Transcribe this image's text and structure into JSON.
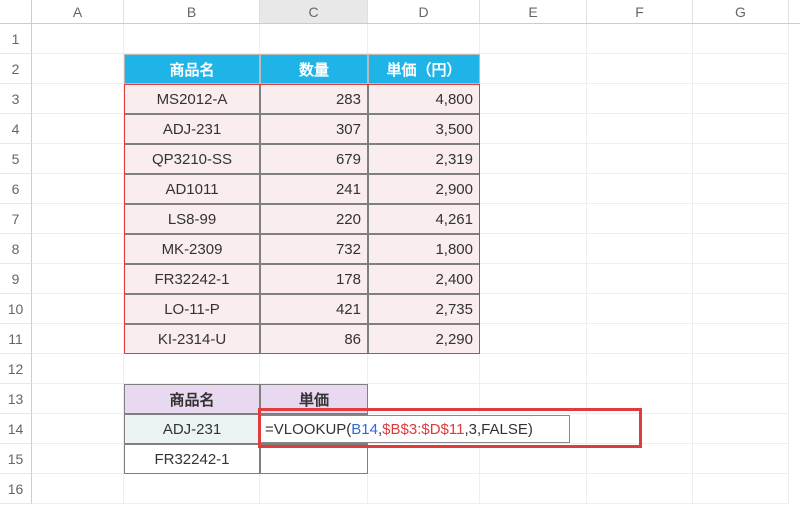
{
  "columns": [
    "A",
    "B",
    "C",
    "D",
    "E",
    "F",
    "G"
  ],
  "selected_column_idx": 2,
  "rows": [
    "1",
    "2",
    "3",
    "4",
    "5",
    "6",
    "7",
    "8",
    "9",
    "10",
    "11",
    "12",
    "13",
    "14",
    "15",
    "16"
  ],
  "table1": {
    "headers": {
      "name": "商品名",
      "qty": "数量",
      "price": "単価（円）"
    },
    "data": [
      {
        "name": "MS2012-A",
        "qty": "283",
        "price": "4,800"
      },
      {
        "name": "ADJ-231",
        "qty": "307",
        "price": "3,500"
      },
      {
        "name": "QP3210-SS",
        "qty": "679",
        "price": "2,319"
      },
      {
        "name": "AD1011",
        "qty": "241",
        "price": "2,900"
      },
      {
        "name": "LS8-99",
        "qty": "220",
        "price": "4,261"
      },
      {
        "name": "MK-2309",
        "qty": "732",
        "price": "1,800"
      },
      {
        "name": "FR32242-1",
        "qty": "178",
        "price": "2,400"
      },
      {
        "name": "LO-11-P",
        "qty": "421",
        "price": "2,735"
      },
      {
        "name": "KI-2314-U",
        "qty": "86",
        "price": "2,290"
      }
    ]
  },
  "lookup": {
    "headers": {
      "name": "商品名",
      "price": "単価"
    },
    "rows": [
      {
        "name": "ADJ-231"
      },
      {
        "name": "FR32242-1"
      }
    ]
  },
  "formula": {
    "raw": "=VLOOKUP(B14,$B$3:$D$11,3,FALSE)",
    "prefix": "=VLOOKUP(",
    "ref1": "B14",
    "sep1": ",",
    "ref2": "$B$3:$D$11",
    "sep2": ",",
    "arg3": "3",
    "sep3": ",",
    "arg4": "FALSE",
    "suffix": ")"
  },
  "chart_data": {
    "type": "table",
    "title": "",
    "columns": [
      "商品名",
      "数量",
      "単価（円）"
    ],
    "rows": [
      [
        "MS2012-A",
        283,
        4800
      ],
      [
        "ADJ-231",
        307,
        3500
      ],
      [
        "QP3210-SS",
        679,
        2319
      ],
      [
        "AD1011",
        241,
        2900
      ],
      [
        "LS8-99",
        220,
        4261
      ],
      [
        "MK-2309",
        732,
        1800
      ],
      [
        "FR32242-1",
        178,
        2400
      ],
      [
        "LO-11-P",
        421,
        2735
      ],
      [
        "KI-2314-U",
        86,
        2290
      ]
    ]
  }
}
